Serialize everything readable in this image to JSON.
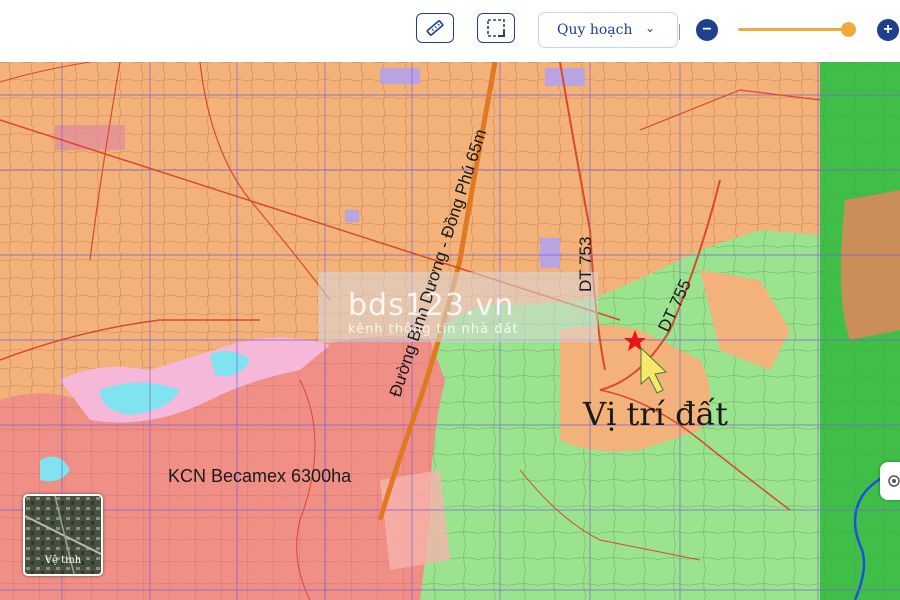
{
  "toolbar": {
    "measure_icon": "ruler-icon",
    "select_icon": "dashed-square-icon",
    "layer_select": {
      "value": "Quy hoạch"
    },
    "zoom_out_label": "−",
    "zoom_in_label": "+",
    "zoom_level_fraction": 0.93
  },
  "map": {
    "labels": {
      "road_main": "Đường Bình Dương - Đồng Phú 65m",
      "road_dt753": "DT 753",
      "road_dt755": "DT 755",
      "site": "Vị trí đất",
      "industrial_zone": "KCN Becamex 6300ha"
    },
    "watermark": {
      "brand": "bds123.vn",
      "tagline": "kênh thông tin nhà đất"
    },
    "marker_icon": "red-star-icon",
    "pointer_icon": "yellow-arrow-icon",
    "colors": {
      "residential": "#f2b27a",
      "industrial": "#f08f86",
      "agricultural": "#9be38f",
      "forest": "#3fbf47",
      "roads": "#d84a2a",
      "grid": "#7a5fe0",
      "water": "#7fe3f0"
    }
  },
  "satellite_toggle": {
    "label": "Vệ tinh"
  }
}
